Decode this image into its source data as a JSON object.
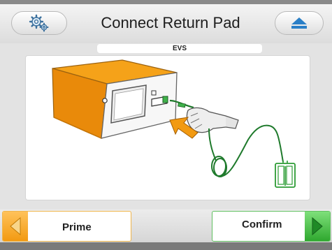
{
  "header": {
    "title": "Connect Return Pad",
    "settings_icon": "gears-icon",
    "eject_icon": "eject-icon"
  },
  "device_label": "EVS",
  "illustration": {
    "description_icons": [
      "generator-device-icon",
      "hand-icon",
      "arrow-icon",
      "return-pad-icon"
    ]
  },
  "footer": {
    "prime_label": "Prime",
    "confirm_label": "Confirm"
  },
  "colors": {
    "accent_orange": "#f29a12",
    "accent_green": "#2fa82f",
    "eject_blue": "#2a7fc7"
  }
}
